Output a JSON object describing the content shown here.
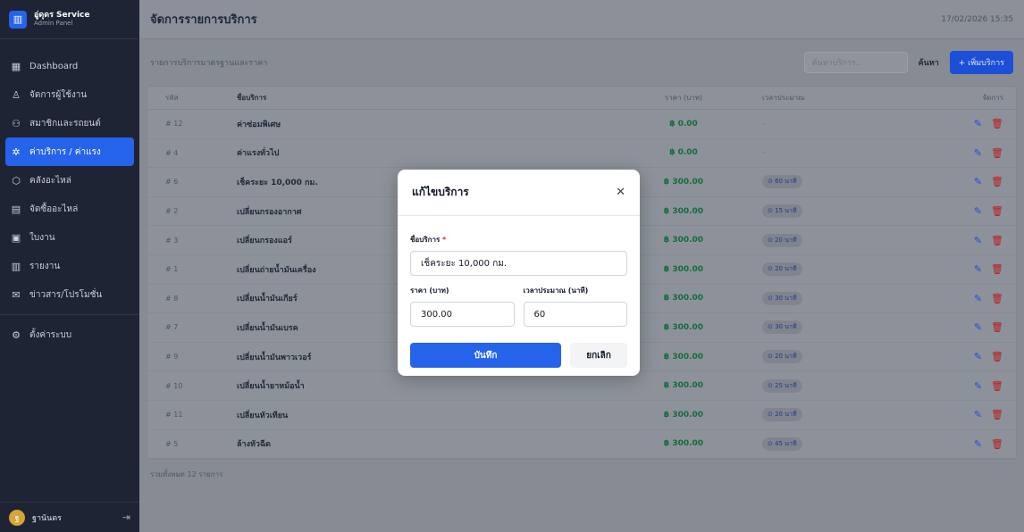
{
  "brand": {
    "name": "อู่ดุดร Service",
    "subtitle": "Admin Panel",
    "logo_icon": "building-icon"
  },
  "sidebar": {
    "items": [
      {
        "label": "Dashboard",
        "icon": "grid-icon",
        "glyph": "▦"
      },
      {
        "label": "จัดการผู้ใช้งาน",
        "icon": "user-icon",
        "glyph": "♙"
      },
      {
        "label": "สมาชิกและรถยนต์",
        "icon": "users-icon",
        "glyph": "⚇"
      },
      {
        "label": "ค่าบริการ / ค่าแรง",
        "icon": "service-icon",
        "glyph": "✲",
        "active": true
      },
      {
        "label": "คลังอะไหล่",
        "icon": "box-icon",
        "glyph": "⬡"
      },
      {
        "label": "จัดซื้ออะไหล่",
        "icon": "cart-icon",
        "glyph": "▤"
      },
      {
        "label": "ใบงาน",
        "icon": "clipboard-icon",
        "glyph": "▣"
      },
      {
        "label": "รายงาน",
        "icon": "chart-icon",
        "glyph": "▥"
      },
      {
        "label": "ข่าวสาร/โปรโมชั่น",
        "icon": "megaphone-icon",
        "glyph": "✉"
      }
    ],
    "settings": {
      "label": "ตั้งค่าระบบ",
      "icon": "gear-icon",
      "glyph": "⚙"
    },
    "user": {
      "initial": "ฐ",
      "name": "ฐานันดร"
    }
  },
  "header": {
    "title": "จัดการรายการบริการ",
    "datetime": "17/02/2026 15:35"
  },
  "toolbar": {
    "section_label": "รายการบริการมาตรฐานและราคา",
    "search_placeholder": "ค้นหาบริการ...",
    "search_label": "ค้นหา",
    "add_label": "+ เพิ่มบริการ"
  },
  "table": {
    "columns": {
      "id": "รหัส",
      "name": "ชื่อบริการ",
      "price": "ราคา (บาท)",
      "time": "เวลาประมาณ",
      "actions": "จัดการ"
    },
    "rows": [
      {
        "id": "# 12",
        "name": "ค่าซ่อมพิเศษ",
        "price": "฿ 0.00",
        "time": "-"
      },
      {
        "id": "# 4",
        "name": "ค่าแรงทั่วไป",
        "price": "฿ 0.00",
        "time": "-"
      },
      {
        "id": "# 6",
        "name": "เช็คระยะ 10,000 กม.",
        "price": "฿ 300.00",
        "time": "⊙ 60 นาที"
      },
      {
        "id": "# 2",
        "name": "เปลี่ยนกรองอากาศ",
        "price": "฿ 300.00",
        "time": "⊙ 15 นาที"
      },
      {
        "id": "# 3",
        "name": "เปลี่ยนกรองแอร์",
        "price": "฿ 300.00",
        "time": "⊙ 20 นาที"
      },
      {
        "id": "# 1",
        "name": "เปลี่ยนถ่ายน้ำมันเครื่อง",
        "price": "฿ 300.00",
        "time": "⊙ 20 นาที"
      },
      {
        "id": "# 8",
        "name": "เปลี่ยนน้ำมันเกียร์",
        "price": "฿ 300.00",
        "time": "⊙ 30 นาที"
      },
      {
        "id": "# 7",
        "name": "เปลี่ยนน้ำมันเบรค",
        "price": "฿ 300.00",
        "time": "⊙ 30 นาที"
      },
      {
        "id": "# 9",
        "name": "เปลี่ยนน้ำมันพาวเวอร์",
        "price": "฿ 300.00",
        "time": "⊙ 20 นาที"
      },
      {
        "id": "# 10",
        "name": "เปลี่ยนน้ำยาหม้อน้ำ",
        "price": "฿ 300.00",
        "time": "⊙ 25 นาที"
      },
      {
        "id": "# 11",
        "name": "เปลี่ยนหัวเทียน",
        "price": "฿ 300.00",
        "time": "⊙ 20 นาที"
      },
      {
        "id": "# 5",
        "name": "ล้างหัวฉีด",
        "price": "฿ 300.00",
        "time": "⊙ 45 นาที"
      }
    ],
    "footer": "รวมทั้งหมด 12 รายการ"
  },
  "modal": {
    "title": "แก้ไขบริการ",
    "close_glyph": "✕",
    "name_label": "ชื่อบริการ",
    "required_mark": "*",
    "name_value": "เช็คระยะ 10,000 กม.",
    "price_label": "ราคา (บาท)",
    "price_value": "300.00",
    "time_label": "เวลาประมาณ (นาที)",
    "time_value": "60",
    "save_label": "บันทึก",
    "cancel_label": "ยกเลิก"
  },
  "colors": {
    "primary": "#2563eb",
    "sidebar": "#1e2433",
    "price": "#146c3a",
    "delete": "#b91c1c"
  }
}
